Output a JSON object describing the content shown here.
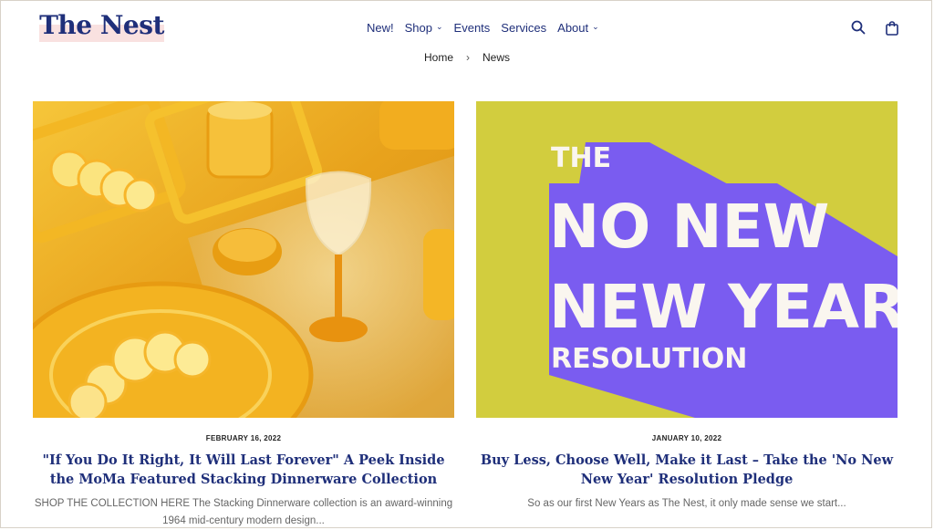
{
  "brand": {
    "name": "The Nest",
    "accent": "#1f2f7a",
    "highlight": "#f9e1e0"
  },
  "nav": {
    "items": [
      {
        "label": "New!",
        "has_dropdown": false
      },
      {
        "label": "Shop",
        "has_dropdown": true
      },
      {
        "label": "Events",
        "has_dropdown": false
      },
      {
        "label": "Services",
        "has_dropdown": false
      },
      {
        "label": "About",
        "has_dropdown": true
      }
    ],
    "icons": [
      "search-icon",
      "shopping-bag-icon"
    ]
  },
  "breadcrumb": {
    "home": "Home",
    "current": "News"
  },
  "posts": [
    {
      "date": "FEBRUARY 16, 2022",
      "title": "\"If You Do It Right, It Will Last Forever\" A Peek Inside the MoMa Featured Stacking Dinnerware Collection",
      "excerpt": "SHOP THE COLLECTION HERE   The Stacking Dinnerware collection is an award-winning 1964 mid-century modern design...",
      "image_colors": [
        "#e5a118",
        "#f7c531"
      ]
    },
    {
      "date": "JANUARY 10, 2022",
      "title": "Buy Less, Choose Well, Make it Last – Take the 'No New New Year' Resolution Pledge",
      "excerpt": "So as our first New Years as The Nest, it only made sense we start...",
      "image_text": {
        "line1": "THE",
        "line2": "NO NEW",
        "line3": "NEW YEAR",
        "line4": "RESOLUTION"
      },
      "image_colors": [
        "#d2cd3e",
        "#7a5cf0",
        "#faf6ef"
      ]
    }
  ]
}
